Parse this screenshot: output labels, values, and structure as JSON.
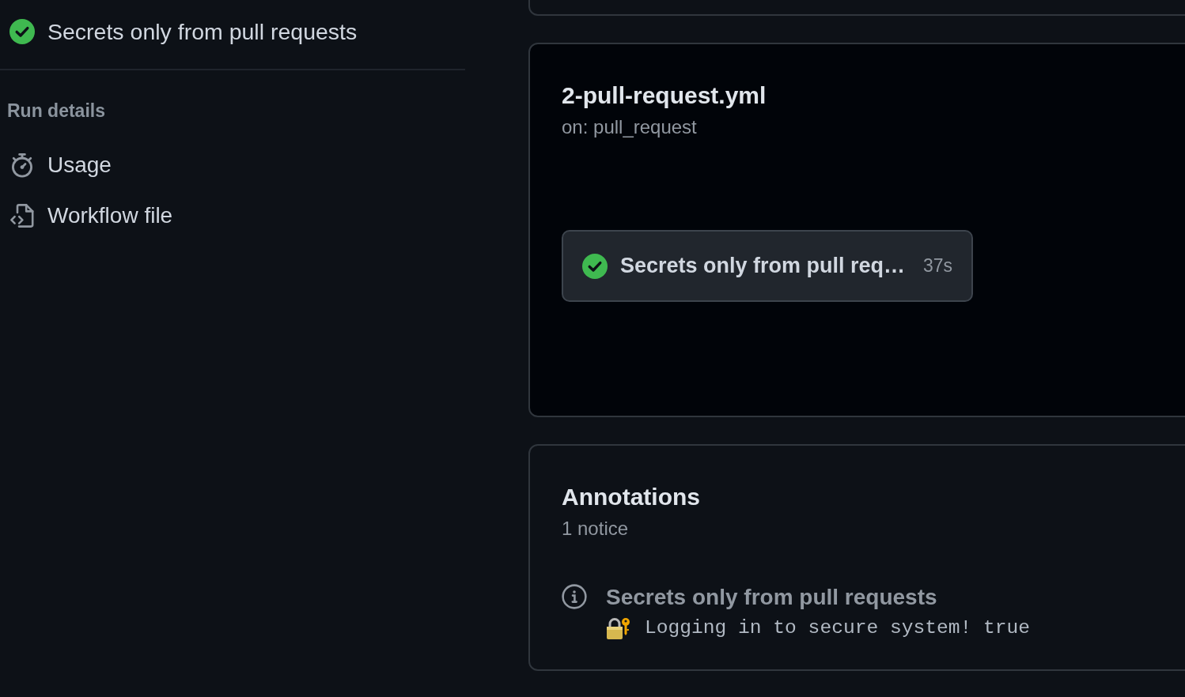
{
  "sidebar": {
    "jobs": [
      {
        "name": "Secrets only from pull requests",
        "passed": true
      }
    ],
    "run_details_heading": "Run details",
    "run_details": [
      {
        "label": "Usage",
        "kind": "usage"
      },
      {
        "label": "Workflow file",
        "kind": "workflow"
      }
    ]
  },
  "workflow": {
    "file": "2-pull-request.yml",
    "trigger": "on: pull_request",
    "jobs": [
      {
        "name": "Secrets only from pull req…",
        "duration": "37s",
        "passed": true
      }
    ]
  },
  "annotations": {
    "title": "Annotations",
    "count": "1 notice",
    "items": [
      {
        "kind": "notice",
        "title": "Secrets only from pull requests",
        "message": "Logging in to secure system! true"
      }
    ]
  }
}
